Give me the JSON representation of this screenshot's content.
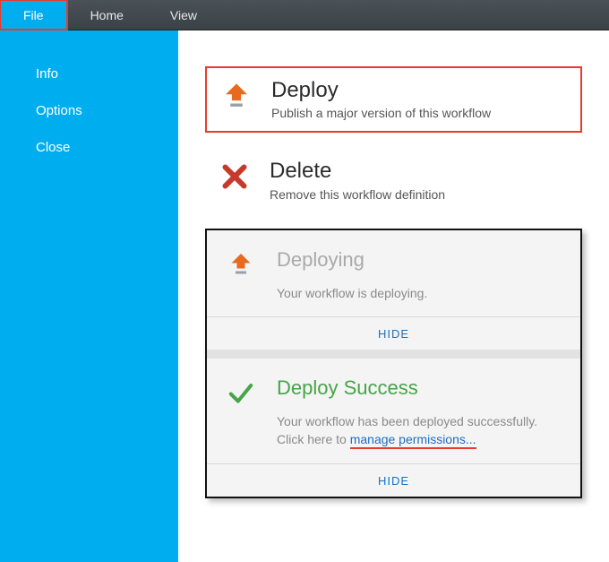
{
  "menubar": {
    "items": [
      {
        "label": "File",
        "active": true
      },
      {
        "label": "Home",
        "active": false
      },
      {
        "label": "View",
        "active": false
      }
    ]
  },
  "sidebar": {
    "items": [
      {
        "label": "Info"
      },
      {
        "label": "Options"
      },
      {
        "label": "Close"
      }
    ]
  },
  "actions": {
    "deploy": {
      "title": "Deploy",
      "subtitle": "Publish a major version of this workflow"
    },
    "delete": {
      "title": "Delete",
      "subtitle": "Remove this workflow definition"
    }
  },
  "cards": {
    "deploying": {
      "title": "Deploying",
      "desc": "Your workflow is deploying.",
      "hide": "HIDE"
    },
    "success": {
      "title": "Deploy Success",
      "desc_prefix": "Your workflow has been deployed successfully. Click here to ",
      "link": "manage permissions...",
      "hide": "HIDE"
    }
  },
  "icons": {
    "deploy": "deploy-icon",
    "delete": "delete-icon",
    "check": "check-icon"
  },
  "colors": {
    "accent": "#00aeef",
    "danger": "#e63b2e",
    "muted": "#a9a9a9",
    "linkBlue": "#1d6fbf",
    "successGreen": "#47a447",
    "deployOrange": "#e86a1f"
  }
}
